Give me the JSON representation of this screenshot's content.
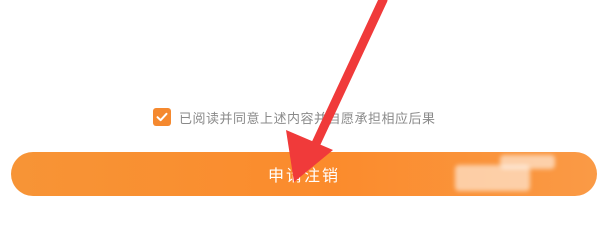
{
  "agreement": {
    "checked": true,
    "text": "已阅读并同意上述内容并自愿承担相应后果"
  },
  "submit_button": {
    "label": "申请注销"
  },
  "colors": {
    "accent": "#fb8b2c",
    "checkbox": "#f5892f",
    "arrow": "#f03a3a",
    "agreement_text": "#8a8a8a"
  },
  "annotation": {
    "icon": "red-arrow-icon"
  }
}
